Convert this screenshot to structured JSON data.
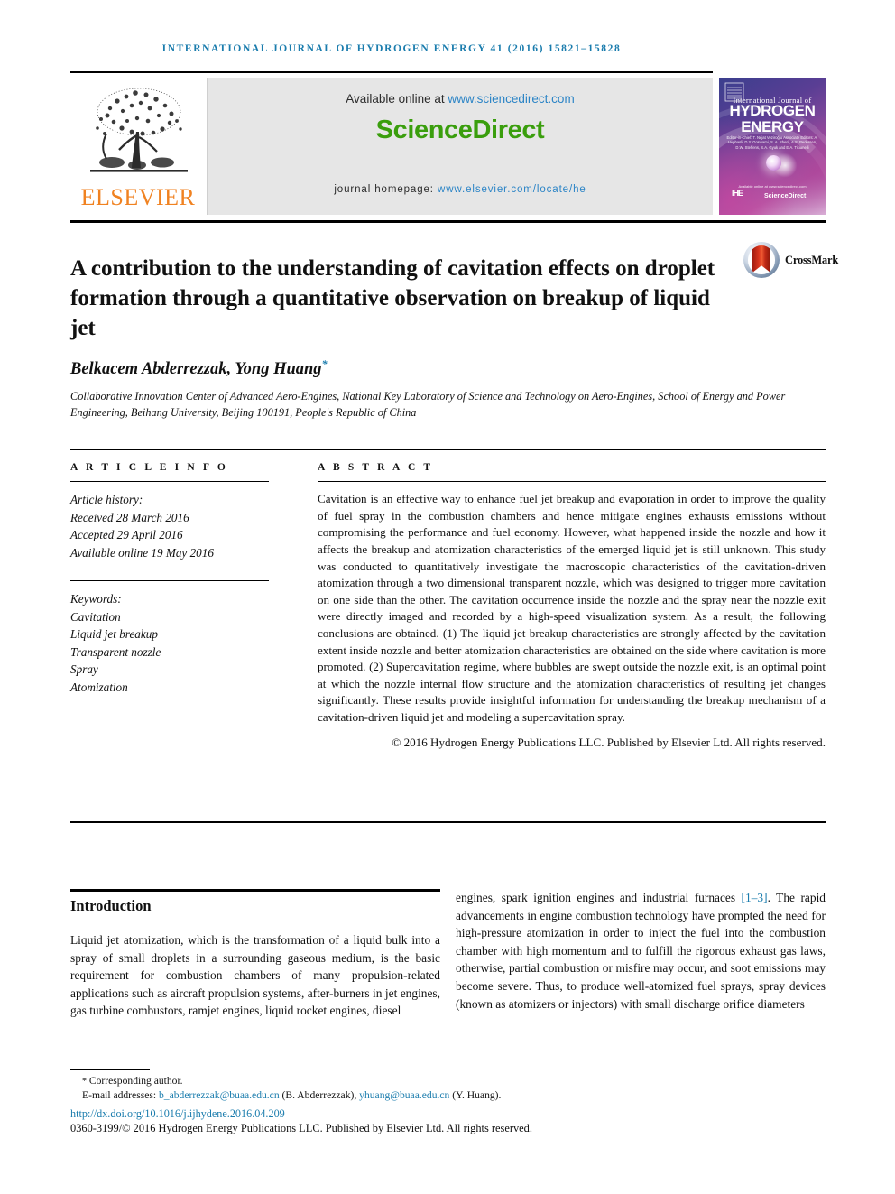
{
  "running_head": "International Journal of Hydrogen Energy 41 (2016) 15821–15828",
  "header": {
    "publisher_logo_label": "ELSEVIER",
    "available_prefix": "Available online at ",
    "available_link": "www.sciencedirect.com",
    "sciencedirect_logo": "ScienceDirect",
    "homepage_prefix": "journal homepage: ",
    "homepage_link": "www.elsevier.com/locate/he"
  },
  "cover": {
    "line_ij": "International Journal of",
    "line_hydrogen": "HYDROGEN",
    "line_energy": "ENERGY",
    "editors": "Editor-in-Chief: T. Nejat Veziroğlu   Associate Editors: A. Hepbasli, D.Y. Goswami, S. A. Sherif, A.S. Pedersen, D.W. Steffens, S.A. Gyuk and E.A. Ticianelli",
    "bottom_note": "Available online at www.sciencedirect.com",
    "ihe_mark": "IHE",
    "sd_mark": "ScienceDirect"
  },
  "article": {
    "title": "A contribution to the understanding of cavitation effects on droplet formation through a quantitative observation on breakup of liquid jet",
    "crossmark_label": "CrossMark",
    "authors": "Belkacem Abderrezzak, Yong Huang",
    "author_marker": "*",
    "affiliation": "Collaborative Innovation Center of Advanced Aero-Engines, National Key Laboratory of Science and Technology on Aero-Engines, School of Energy and Power Engineering, Beihang University, Beijing 100191, People's Republic of China"
  },
  "article_info": {
    "heading": "A R T I C L E   I N F O",
    "history_label": "Article history:",
    "received": "Received 28 March 2016",
    "accepted": "Accepted 29 April 2016",
    "available_online": "Available online 19 May 2016",
    "keywords_label": "Keywords:",
    "keywords": [
      "Cavitation",
      "Liquid jet breakup",
      "Transparent nozzle",
      "Spray",
      "Atomization"
    ]
  },
  "abstract": {
    "heading": "A B S T R A C T",
    "text": "Cavitation is an effective way to enhance fuel jet breakup and evaporation in order to improve the quality of fuel spray in the combustion chambers and hence mitigate engines exhausts emissions without compromising the performance and fuel economy. However, what happened inside the nozzle and how it affects the breakup and atomization characteristics of the emerged liquid jet is still unknown. This study was conducted to quantitatively investigate the macroscopic characteristics of the cavitation-driven atomization through a two dimensional transparent nozzle, which was designed to trigger more cavitation on one side than the other. The cavitation occurrence inside the nozzle and the spray near the nozzle exit were directly imaged and recorded by a high-speed visualization system. As a result, the following conclusions are obtained. (1) The liquid jet breakup characteristics are strongly affected by the cavitation extent inside nozzle and better atomization characteristics are obtained on the side where cavitation is more promoted. (2) Supercavitation regime, where bubbles are swept outside the nozzle exit, is an optimal point at which the nozzle internal flow structure and the atomization characteristics of resulting jet changes significantly. These results provide insightful information for understanding the breakup mechanism of a cavitation-driven liquid jet and modeling a supercavitation spray.",
    "copyright": "© 2016 Hydrogen Energy Publications LLC. Published by Elsevier Ltd. All rights reserved."
  },
  "introduction": {
    "heading": "Introduction",
    "left_paragraph": "Liquid jet atomization, which is the transformation of a liquid bulk into a spray of small droplets in a surrounding gaseous medium, is the basic requirement for combustion chambers of many propulsion-related applications such as aircraft propulsion systems, after-burners in jet engines, gas turbine combustors, ramjet engines, liquid rocket engines, diesel",
    "right_paragraph_pre": "engines, spark ignition engines and industrial furnaces ",
    "right_citation": "[1–3]",
    "right_paragraph_post": ". The rapid advancements in engine combustion technology have prompted the need for high-pressure atomization in order to inject the fuel into the combustion chamber with high momentum and to fulfill the rigorous exhaust gas laws, otherwise, partial combustion or misfire may occur, and soot emissions may become severe. Thus, to produce well-atomized fuel sprays, spray devices (known as atomizers or injectors) with small discharge orifice diameters"
  },
  "footer": {
    "corresponding_marker": "*",
    "corresponding_label": " Corresponding author.",
    "email_label": "E-mail addresses: ",
    "email_1": "b_abderrezzak@buaa.edu.cn",
    "email_1_name": " (B. Abderrezzak), ",
    "email_2": "yhuang@buaa.edu.cn",
    "email_2_name": " (Y. Huang).",
    "doi": "http://dx.doi.org/10.1016/j.ijhydene.2016.04.209",
    "issn_line": "0360-3199/© 2016 Hydrogen Energy Publications LLC. Published by Elsevier Ltd. All rights reserved."
  },
  "colors": {
    "accent_blue": "#1a7cad",
    "link_blue": "#2b84c6",
    "sciencedirect_green": "#3a9e0d",
    "elsevier_orange": "#f08221"
  }
}
